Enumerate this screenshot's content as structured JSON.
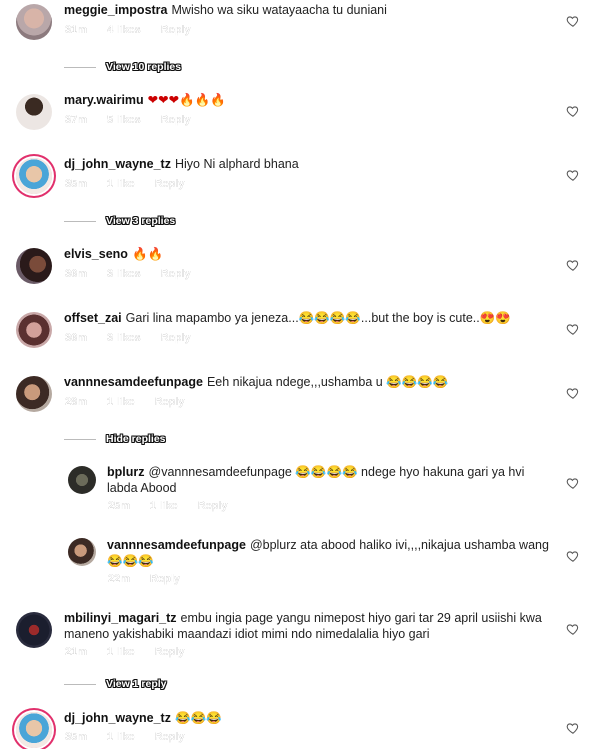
{
  "colors": {
    "background": "#ffffff",
    "text": "#111111",
    "ring": "#e1306c",
    "divider": "#bbbbbb"
  },
  "comments": [
    {
      "user": "meggie_impostra",
      "text": "Mwisho wa siku watayaacha tu duniani",
      "time": "31m",
      "likes": "4 likes",
      "reply": "Reply",
      "view_replies": "View 10 replies"
    },
    {
      "user": "mary.wairimu",
      "text": "❤❤❤🔥🔥🔥",
      "time": "37m",
      "likes": "5 likes",
      "reply": "Reply"
    },
    {
      "user": "dj_john_wayne_tz",
      "text": "Hiyo Ni alphard bhana",
      "time": "35m",
      "likes": "1 like",
      "reply": "Reply",
      "view_replies": "View 3 replies"
    },
    {
      "user": "elvis_seno",
      "text": "🔥🔥",
      "time": "36m",
      "likes": "3 likes",
      "reply": "Reply"
    },
    {
      "user": "offset_zai",
      "text": "Gari lina mapambo ya jeneza...😂😂😂😂...but the boy is cute..😍😍",
      "time": "36m",
      "likes": "3 likes",
      "reply": "Reply"
    },
    {
      "user": "vannnesamdeefunpage",
      "text": "Eeh nikajua ndege,,,ushamba u 😂😂😂😂",
      "time": "28m",
      "likes": "1 like",
      "reply": "Reply",
      "view_replies": "Hide replies"
    },
    {
      "user": "bplurz",
      "text": "@vannnesamdeefunpage 😂😂😂😂 ndege hyo hakuna gari ya hvi labda Abood",
      "time": "25m",
      "likes": "1 like",
      "reply": "Reply"
    },
    {
      "user": "vannnesamdeefunpage",
      "text": "@bplurz ata abood haliko ivi,,,,nikajua ushamba wang😂😂😂",
      "time": "22m",
      "likes": "",
      "reply": "Reply"
    },
    {
      "user": "mbilinyi_magari_tz",
      "text": "embu ingia page yangu nimepost hiyo gari tar 29 april usiishi kwa maneno yakishabiki maandazi idiot mimi ndo nimedalalia hiyo gari",
      "time": "21m",
      "likes": "1 like",
      "reply": "Reply",
      "view_replies": "View 1 reply"
    },
    {
      "user": "dj_john_wayne_tz",
      "text": "😂😂😂",
      "time": "35m",
      "likes": "1 like",
      "reply": "Reply"
    }
  ]
}
